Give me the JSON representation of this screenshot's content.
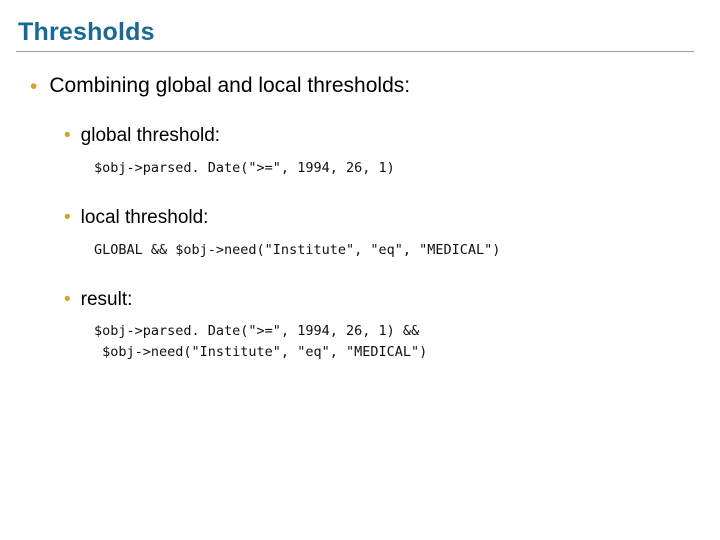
{
  "title": "Thresholds",
  "lvl1": "Combining global and local thresholds:",
  "blocks": [
    {
      "label": "global threshold:",
      "code": "$obj->parsed. Date(\">=\", 1994, 26, 1)"
    },
    {
      "label": "local threshold:",
      "code": "GLOBAL && $obj->need(\"Institute\", \"eq\", \"MEDICAL\")"
    },
    {
      "label": "result:",
      "code": "$obj->parsed. Date(\">=\", 1994, 26, 1) &&\n $obj->need(\"Institute\", \"eq\", \"MEDICAL\")"
    }
  ]
}
